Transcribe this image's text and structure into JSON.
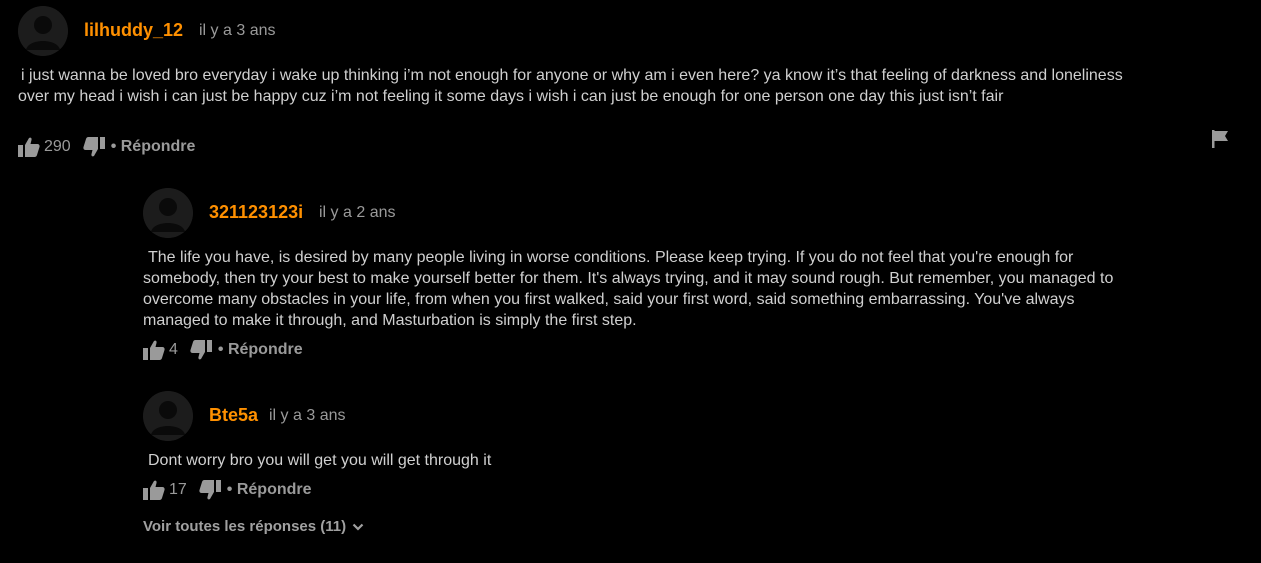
{
  "comments": [
    {
      "username": "lilhuddy_12",
      "time": "il y a 3 ans",
      "text": "i just wanna be loved bro everyday i wake up thinking i’m not enough for anyone or why am i even here? ya know it’s that feeling of darkness and loneliness over my head i wish i can just be happy cuz i’m not feeling it some days i wish i can just be enough for one person one day this just isn’t fair",
      "likes": "290",
      "reply_label": "• Répondre"
    }
  ],
  "replies": [
    {
      "username": "321123123i",
      "time": "il y a 2 ans",
      "text": "The life you have, is desired by many people living in worse conditions. Please keep trying. If you do not feel that you're enough for somebody, then try your best to make yourself better for them. It's always trying, and it may sound rough. But remember, you managed to overcome many obstacles in your life, from when you first walked, said your first word, said something embarrassing. You've always managed to make it through, and Masturbation is simply the first step.",
      "likes": "4",
      "reply_label": "• Répondre"
    },
    {
      "username": "Bte5a",
      "time": "il y a 3 ans",
      "text": "Dont worry bro you will get you will get through it",
      "likes": "17",
      "reply_label": "• Répondre"
    }
  ],
  "see_all_replies": "Voir toutes les réponses (11)",
  "icons": {
    "avatar": "user-silhouette-icon",
    "like": "thumbs-up-icon",
    "dislike": "thumbs-down-icon",
    "flag": "flag-icon",
    "chevron": "chevron-down-icon"
  },
  "colors": {
    "background": "#000000",
    "username": "#ff9000",
    "text": "#d0d0d0",
    "muted": "#9a9a9a"
  }
}
